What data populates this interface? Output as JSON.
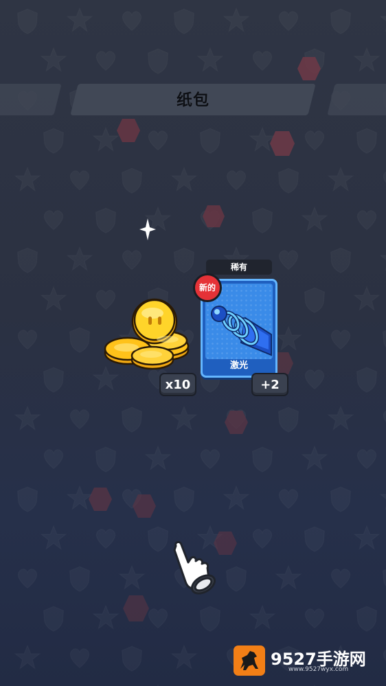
{
  "header": {
    "title": "纸包"
  },
  "rewards": {
    "coins": {
      "icon": "gold-coins-pile-icon",
      "count_label": "x10"
    },
    "card": {
      "rarity": "稀有",
      "new_badge": "新的",
      "name": "激光",
      "art_icon": "blue-spring-cannon-icon",
      "count_label": "+2"
    }
  },
  "tutorial_hint": {
    "icon": "pointing-hand-icon"
  },
  "watermark": {
    "brand": "9527手游网",
    "url": "www.9527wyx.com",
    "logo_icon": "horse-logo-icon"
  },
  "colors": {
    "background": "#2b3142",
    "banner": "#414856",
    "card_blue": "#3a8be8",
    "card_border": "#64b6ff",
    "new_badge_red": "#e53237",
    "hex_red": "#8a3a45",
    "coin_gold": "#ffc21a",
    "watermark_orange": "#f27f16"
  }
}
